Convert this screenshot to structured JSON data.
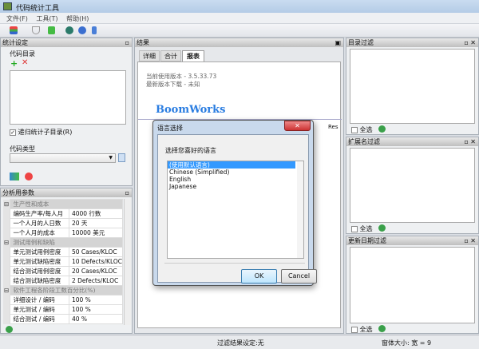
{
  "window": {
    "title": "代码统计工具"
  },
  "menu": [
    "文件(F)",
    "工具(T)",
    "帮助(H)"
  ],
  "left": {
    "settings_title": "统计设定",
    "code_dir_label": "代码目录",
    "recursive_label": "递归统计子目录(R)",
    "recursive_checked": true,
    "code_type_label": "代码类型",
    "code_type_value": "",
    "params_title": "分析用参数",
    "params": [
      {
        "category": "生产性和成本",
        "rows": [
          [
            "编码生产率/每人月",
            "4000 行数"
          ],
          [
            "一个人月的人日数",
            "20 天"
          ],
          [
            "一个人月的成本",
            "10000 美元"
          ]
        ]
      },
      {
        "category": "测试用例和缺陷",
        "rows": [
          [
            "单元测试用例密度",
            "50 Cases/KLOC"
          ],
          [
            "单元测试缺陷密度",
            "10 Defects/KLOC"
          ],
          [
            "结合测试用例密度",
            "20 Cases/KLOC"
          ],
          [
            "结合测试缺陷密度",
            "2 Defects/KLOC"
          ]
        ]
      },
      {
        "category": "软件工程各阶段工数百分比(%)",
        "rows": [
          [
            "详细设计 / 编码",
            "100 %"
          ],
          [
            "单元测试 / 编码",
            "100 %"
          ],
          [
            "结合测试 / 编码",
            "40 %"
          ]
        ]
      }
    ]
  },
  "center": {
    "title": "结果",
    "tabs": [
      "详细",
      "合计",
      "报表"
    ],
    "active_tab": 2,
    "version_line": "当前使用版本 - 3.5.33.73",
    "latest_line": "最新版本下载 - 未知",
    "logo": "BoomWorks",
    "cut_text": "Res"
  },
  "dialog": {
    "title": "语言选择",
    "prompt": "选择您喜好的语言",
    "options": [
      "(使用默认语言)",
      "Chinese (Simplified)",
      "English",
      "Japanese"
    ],
    "selected": 0,
    "ok": "OK",
    "cancel": "Cancel"
  },
  "right": [
    {
      "title": "目录过滤",
      "select_all": "全选"
    },
    {
      "title": "扩展名过滤",
      "select_all": "全选"
    },
    {
      "title": "更新日期过滤",
      "select_all": "全选"
    }
  ],
  "status": {
    "filter": "过滤结果设定:无",
    "size": "窗体大小: 宽 = 9"
  }
}
